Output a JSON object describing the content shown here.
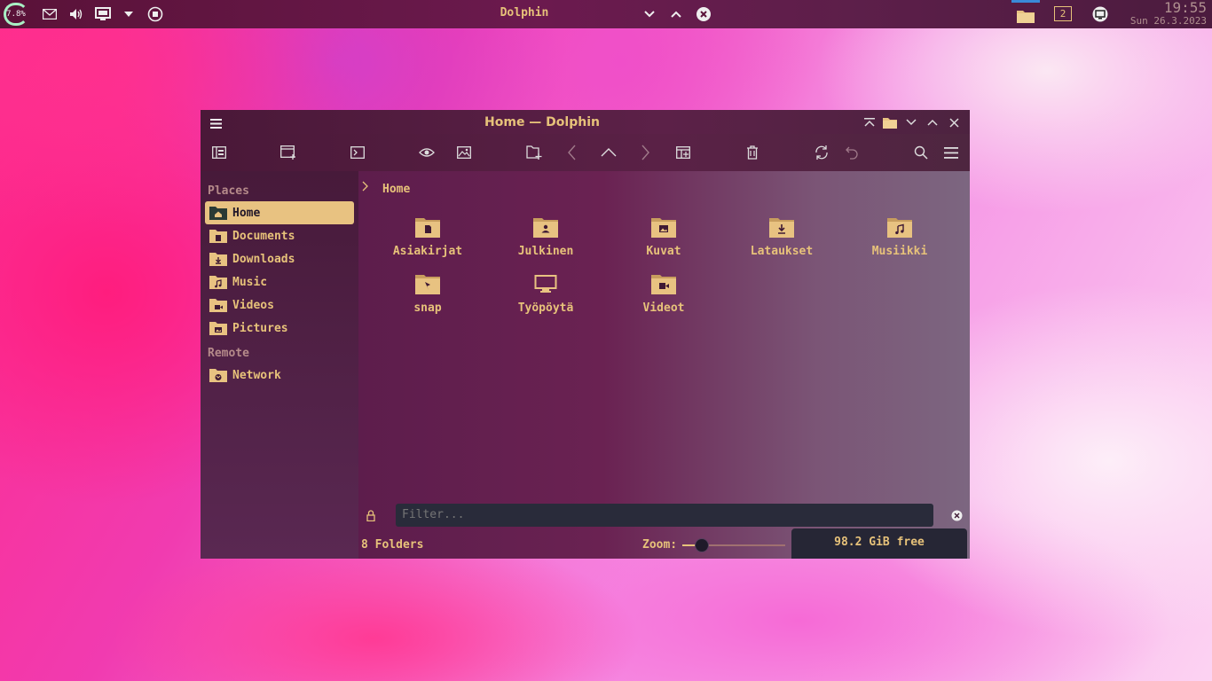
{
  "panel": {
    "cpu_percent": "7.8%",
    "active_window_title": "Dolphin",
    "virtual_desktop": "2",
    "clock_time": "19:55",
    "clock_date": "Sun 26.3.2023"
  },
  "window": {
    "title": "Home — Dolphin"
  },
  "sidebar": {
    "places_label": "Places",
    "remote_label": "Remote",
    "items": [
      {
        "label": "Home",
        "icon": "home-folder-icon"
      },
      {
        "label": "Documents",
        "icon": "documents-folder-icon"
      },
      {
        "label": "Downloads",
        "icon": "downloads-folder-icon"
      },
      {
        "label": "Music",
        "icon": "music-folder-icon"
      },
      {
        "label": "Videos",
        "icon": "videos-folder-icon"
      },
      {
        "label": "Pictures",
        "icon": "pictures-folder-icon"
      }
    ],
    "remote_items": [
      {
        "label": "Network",
        "icon": "network-folder-icon"
      }
    ]
  },
  "breadcrumb": {
    "location": "Home"
  },
  "folders": [
    {
      "label": "Asiakirjat",
      "icon": "documents-folder-icon"
    },
    {
      "label": "Julkinen",
      "icon": "public-folder-icon"
    },
    {
      "label": "Kuvat",
      "icon": "pictures-folder-icon"
    },
    {
      "label": "Lataukset",
      "icon": "downloads-folder-icon"
    },
    {
      "label": "Musiikki",
      "icon": "music-folder-icon"
    },
    {
      "label": "snap",
      "icon": "snap-folder-icon"
    },
    {
      "label": "Työpöytä",
      "icon": "desktop-icon"
    },
    {
      "label": "Videot",
      "icon": "videos-folder-icon"
    }
  ],
  "filter": {
    "placeholder": "Filter..."
  },
  "statusbar": {
    "summary": "8 Folders",
    "zoom_label": "Zoom:",
    "zoom_level": 0.19,
    "free_space": "98.2 GiB free"
  },
  "colors": {
    "accent": "#e8c281",
    "text": "#e7c27a",
    "filter_bg": "#292b3a"
  }
}
